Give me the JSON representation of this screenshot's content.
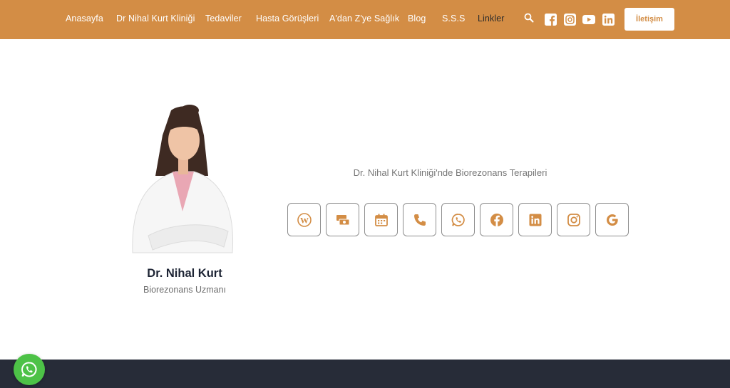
{
  "header": {
    "background_color": "#d38d45",
    "nav": [
      {
        "label": "Anasayfa",
        "active": false
      },
      {
        "label": "Dr Nihal Kurt Kliniği",
        "active": false
      },
      {
        "label": "Tedaviler",
        "active": false
      },
      {
        "label": "Hasta Görüşleri",
        "active": false
      },
      {
        "label": "A'dan Z'ye Sağlık",
        "active": false
      },
      {
        "label": "Blog",
        "active": false
      },
      {
        "label": "S.S.S",
        "active": false
      },
      {
        "label": "Linkler",
        "active": true
      }
    ],
    "icons": [
      "search-icon",
      "facebook-icon",
      "instagram-icon",
      "youtube-icon",
      "linkedin-icon"
    ],
    "contact_button_label": "İletişim"
  },
  "profile": {
    "name": "Dr. Nihal Kurt",
    "title": "Biorezonans Uzmanı"
  },
  "main": {
    "headline": "Dr. Nihal Kurt Kliniği'nde Biorezonans Terapileri",
    "accent_color": "#d38d45",
    "link_icons": [
      "wordpress-icon",
      "money-icon",
      "calendar-icon",
      "phone-icon",
      "whatsapp-icon",
      "facebook-icon",
      "linkedin-icon",
      "instagram-icon",
      "google-icon"
    ]
  },
  "footer": {
    "background_color": "#272c38"
  },
  "floating": {
    "icon": "whatsapp-icon",
    "color": "#4dc247"
  }
}
